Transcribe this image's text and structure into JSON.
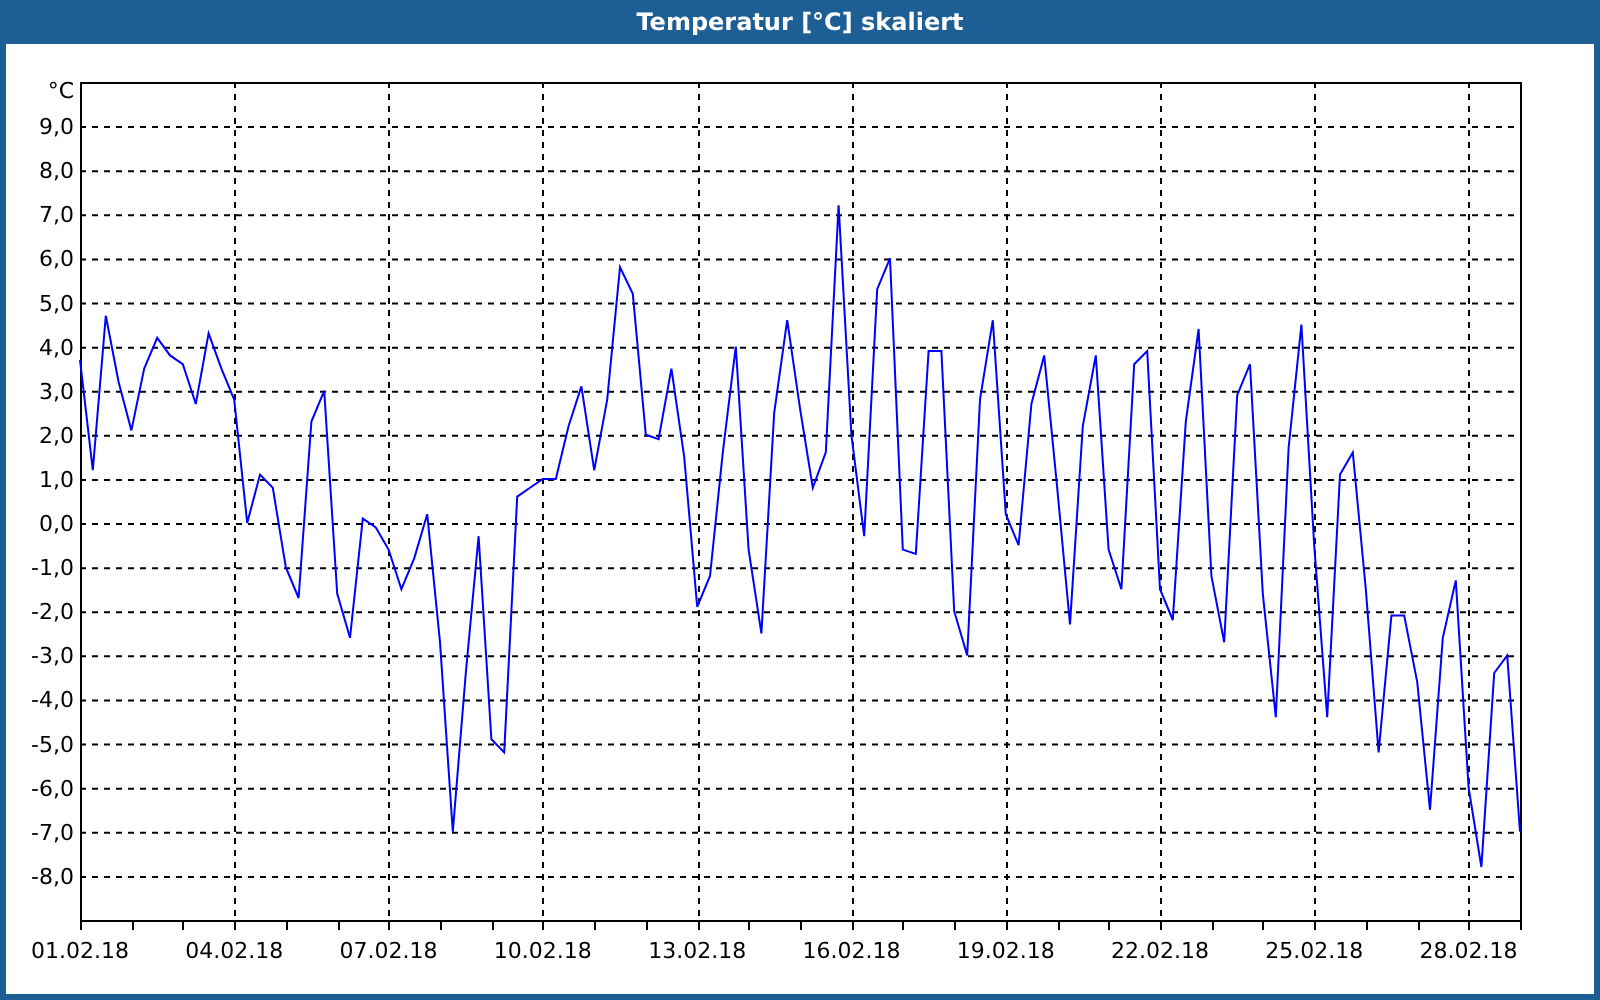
{
  "window": {
    "title": "Temperatur [°C] skaliert"
  },
  "chart": {
    "chart_data": {
      "type": "line",
      "grid": true,
      "ylabel": "°C",
      "ylim": [
        -9,
        10
      ],
      "categories": [
        "01.02.18",
        null,
        null,
        null,
        null,
        null,
        null,
        null,
        null,
        null,
        null,
        null,
        "04.02.18",
        null,
        null,
        null,
        null,
        null,
        null,
        null,
        null,
        null,
        null,
        null,
        "07.02.18",
        null,
        null,
        null,
        null,
        null,
        null,
        null,
        null,
        null,
        null,
        null,
        "10.02.18",
        null,
        null,
        null,
        null,
        null,
        null,
        null,
        null,
        null,
        null,
        null,
        "13.02.18",
        null,
        null,
        null,
        null,
        null,
        null,
        null,
        null,
        null,
        null,
        null,
        "16.02.18",
        null,
        null,
        null,
        null,
        null,
        null,
        null,
        null,
        null,
        null,
        null,
        "19.02.18",
        null,
        null,
        null,
        null,
        null,
        null,
        null,
        null,
        null,
        null,
        null,
        "22.02.18",
        null,
        null,
        null,
        null,
        null,
        null,
        null,
        null,
        null,
        null,
        null,
        "25.02.18",
        null,
        null,
        null,
        null,
        null,
        null,
        null,
        null,
        null,
        null,
        null,
        "28.02.18",
        null,
        null,
        null,
        null
      ],
      "yticks": [
        {
          "value": -8,
          "label": "-8,0"
        },
        {
          "value": -7,
          "label": "-7,0"
        },
        {
          "value": -6,
          "label": "-6,0"
        },
        {
          "value": -5,
          "label": "-5,0"
        },
        {
          "value": -4,
          "label": "-4,0"
        },
        {
          "value": -3,
          "label": "-3,0"
        },
        {
          "value": -2,
          "label": "-2,0"
        },
        {
          "value": -1,
          "label": "-1,0"
        },
        {
          "value": 0,
          "label": "0,0"
        },
        {
          "value": 1,
          "label": "1,0"
        },
        {
          "value": 2,
          "label": "2,0"
        },
        {
          "value": 3,
          "label": "3,0"
        },
        {
          "value": 4,
          "label": "4,0"
        },
        {
          "value": 5,
          "label": "5,0"
        },
        {
          "value": 6,
          "label": "6,0"
        },
        {
          "value": 7,
          "label": "7,0"
        },
        {
          "value": 8,
          "label": "8,0"
        },
        {
          "value": 9,
          "label": "9,0"
        }
      ],
      "series": [
        {
          "color": "#0000ff",
          "values": [
            3.7,
            1.2,
            4.7,
            3.2,
            2.1,
            3.5,
            4.2,
            3.8,
            3.6,
            2.7,
            4.3,
            3.5,
            2.8,
            0.0,
            1.1,
            0.8,
            -1.0,
            -1.7,
            2.3,
            3.0,
            -1.6,
            -2.6,
            0.1,
            -0.1,
            -0.6,
            -1.5,
            -0.8,
            0.2,
            -2.7,
            -7.0,
            -3.4,
            -0.3,
            -4.9,
            -5.2,
            0.6,
            0.8,
            1.0,
            1.0,
            2.2,
            3.1,
            1.2,
            2.8,
            5.8,
            5.2,
            2.0,
            1.9,
            3.5,
            1.5,
            -1.9,
            -1.2,
            1.6,
            4.0,
            -0.6,
            -2.5,
            2.5,
            4.6,
            2.6,
            0.8,
            1.6,
            7.2,
            2.0,
            -0.3,
            5.3,
            6.0,
            -0.6,
            -0.7,
            3.9,
            3.9,
            -2.0,
            -3.0,
            2.8,
            4.6,
            0.2,
            -0.5,
            2.7,
            3.8,
            0.8,
            -2.3,
            2.2,
            3.8,
            -0.6,
            -1.5,
            3.6,
            3.9,
            -1.5,
            -2.2,
            2.3,
            4.4,
            -1.2,
            -2.7,
            2.9,
            3.6,
            -1.6,
            -4.4,
            1.7,
            4.5,
            -0.5,
            -4.4,
            1.1,
            1.6,
            -1.5,
            -5.2,
            -2.1,
            -2.1,
            -3.6,
            -6.5,
            -2.6,
            -1.3,
            -6.0,
            -7.8,
            -3.4,
            -3.0,
            -7.0
          ]
        }
      ]
    }
  }
}
